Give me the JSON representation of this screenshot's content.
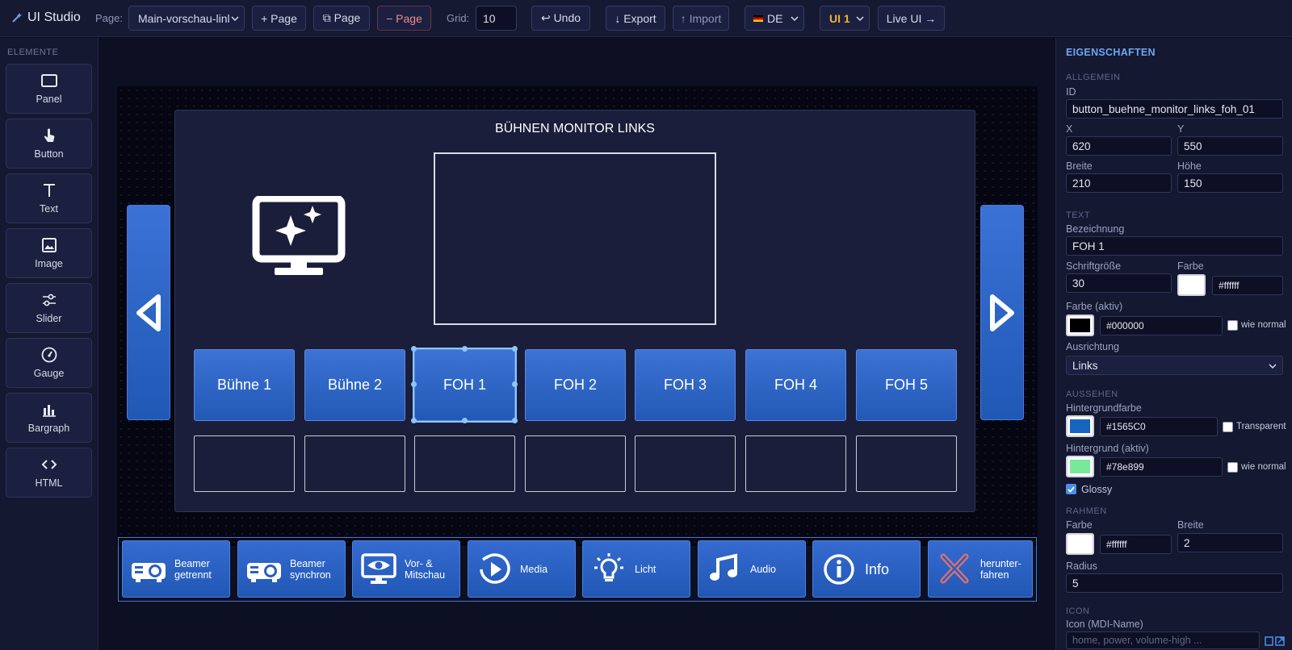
{
  "app": {
    "title": "UI Studio"
  },
  "toolbar": {
    "page_label": "Page:",
    "page_value": "Main-vorschau-linl",
    "add_page": "+ Page",
    "copy_page": "⧉ Page",
    "remove_page": "− Page",
    "grid_label": "Grid:",
    "grid_value": "10",
    "undo": "↩ Undo",
    "export": "↓ Export",
    "import": "↑ Import",
    "lang": "DE",
    "ui_select": "UI 1",
    "live": "Live UI →"
  },
  "sidebar": {
    "title": "ELEMENTE",
    "tools": [
      {
        "label": "Panel",
        "icon": "panel-icon"
      },
      {
        "label": "Button",
        "icon": "hand-pointer-icon"
      },
      {
        "label": "Text",
        "icon": "text-icon"
      },
      {
        "label": "Image",
        "icon": "image-icon"
      },
      {
        "label": "Slider",
        "icon": "slider-icon"
      },
      {
        "label": "Gauge",
        "icon": "gauge-icon"
      },
      {
        "label": "Bargraph",
        "icon": "bargraph-icon"
      },
      {
        "label": "HTML",
        "icon": "code-icon"
      }
    ]
  },
  "canvas": {
    "panel_title": "BÜHNEN MONITOR LINKS",
    "source_buttons": [
      "Bühne 1",
      "Bühne 2",
      "FOH 1",
      "FOH 2",
      "FOH 3",
      "FOH 4",
      "FOH 5"
    ],
    "selected": "FOH 1",
    "bottom_buttons": [
      {
        "label": "Beamer getrennt",
        "icon": "projector-icon"
      },
      {
        "label": "Beamer synchron",
        "icon": "projector-icon"
      },
      {
        "label": "Vor- & Mitschau",
        "icon": "monitor-eye-icon"
      },
      {
        "label": "Media",
        "icon": "play-circle-icon"
      },
      {
        "label": "Licht",
        "icon": "lightbulb-icon"
      },
      {
        "label": "Audio",
        "icon": "music-note-icon"
      },
      {
        "label": "Info",
        "icon": "info-icon"
      },
      {
        "label": "herunter-fahren",
        "icon": "close-x-icon"
      }
    ]
  },
  "props": {
    "title": "EIGENSCHAFTEN",
    "allgemein": "ALLGEMEIN",
    "id_label": "ID",
    "id_value": "button_buehne_monitor_links_foh_01",
    "x_label": "X",
    "x_value": "620",
    "y_label": "Y",
    "y_value": "550",
    "w_label": "Breite",
    "w_value": "210",
    "h_label": "Höhe",
    "h_value": "150",
    "text_section": "TEXT",
    "bez_label": "Bezeichnung",
    "bez_value": "FOH 1",
    "size_label": "Schriftgröße",
    "size_value": "30",
    "farbe_label": "Farbe",
    "farbe_value": "#ffffff",
    "farbe_aktiv_label": "Farbe (aktiv)",
    "farbe_aktiv_value": "#000000",
    "wie_normal": "wie normal",
    "ausrichtung_label": "Ausrichtung",
    "ausrichtung_value": "Links",
    "aussehen": "AUSSEHEN",
    "hg_label": "Hintergrundfarbe",
    "hg_value": "#1565C0",
    "transparent": "Transparent",
    "hg_aktiv_label": "Hintergrund (aktiv)",
    "hg_aktiv_value": "#78e899",
    "glossy": "Glossy",
    "rahmen": "RAHMEN",
    "rahmen_farbe_label": "Farbe",
    "rahmen_farbe_value": "#ffffff",
    "rahmen_breite_label": "Breite",
    "rahmen_breite_value": "2",
    "radius_label": "Radius",
    "radius_value": "5",
    "icon_section": "ICON",
    "icon_label": "Icon (MDI-Name)",
    "icon_placeholder": "home, power, volume-high ..."
  },
  "colors": {
    "accent": "#1565C0",
    "active_bg": "#78e899",
    "selection": "#8cc6ff"
  }
}
